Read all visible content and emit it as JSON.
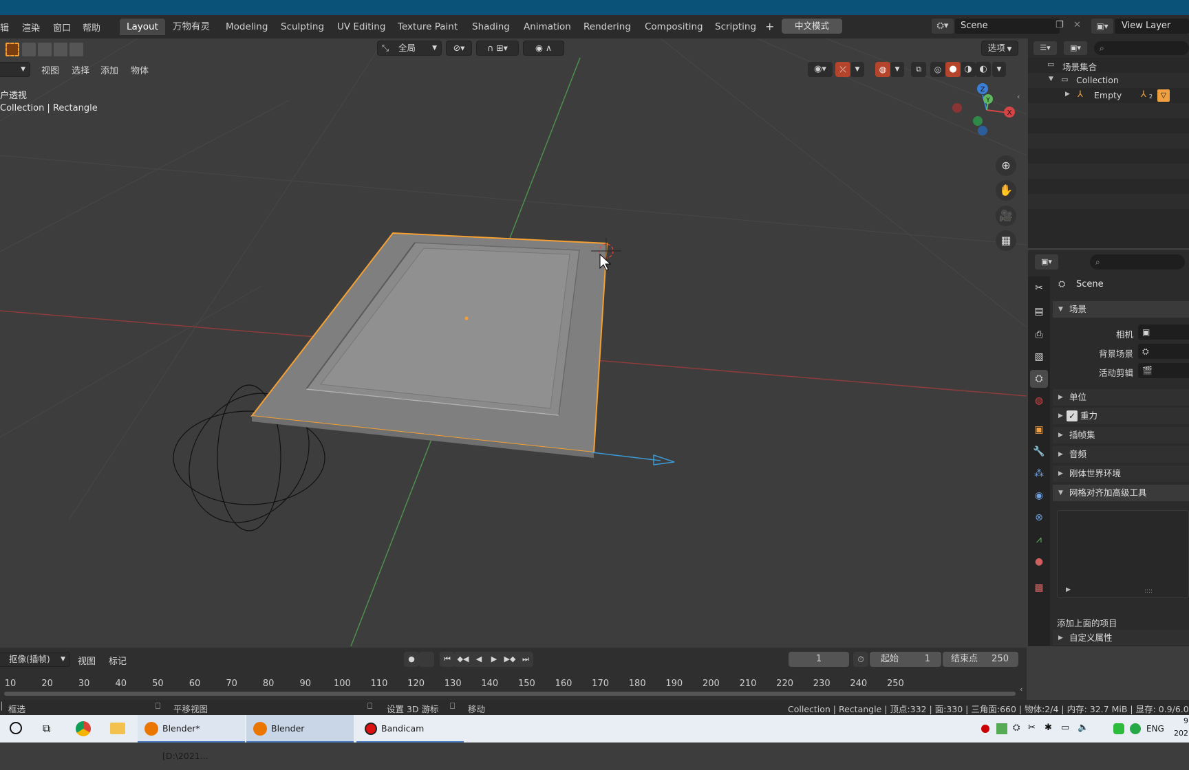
{
  "menubar": {
    "items": [
      "编辑",
      "渲染",
      "窗口",
      "帮助"
    ],
    "display_items": [
      "辑",
      "渲染",
      "窗口",
      "帮助"
    ]
  },
  "workspaces": [
    "Layout",
    "万物有灵",
    "Modeling",
    "Sculpting",
    "UV Editing",
    "Texture Paint",
    "Shading",
    "Animation",
    "Rendering",
    "Compositing",
    "Scripting"
  ],
  "active_workspace": "Layout",
  "add_workspace": "+",
  "chinese_mode": "中文模式",
  "scene_name": "Scene",
  "view_layer": "View Layer",
  "viewport": {
    "transform_orientation": "全局",
    "options_label": "选项",
    "menu": [
      "视图",
      "选择",
      "添加",
      "物体"
    ],
    "overlay_line1": "户透视",
    "overlay_line2": "Collection | Rectangle"
  },
  "outliner": {
    "scene_collection": "场景集合",
    "collection": "Collection",
    "empty": "Empty",
    "child_count": "2"
  },
  "properties": {
    "scene_label": "Scene",
    "panel_scene": "场景",
    "camera": "相机",
    "background_scene": "背景场景",
    "active_clip": "活动剪辑",
    "units": "单位",
    "gravity": "重力",
    "keying_sets": "插帧集",
    "audio": "音频",
    "rigid_body_world": "刚体世界环境",
    "mesh_align_tools": "网格对齐加高级工具",
    "add_item": "添加上面的项目",
    "custom_props": "自定义属性"
  },
  "timeline": {
    "mode": "抠像(插帧)",
    "view": "视图",
    "marker": "标记",
    "current_frame": "1",
    "start_label": "起始",
    "start_value": "1",
    "end_label": "结束点",
    "end_value": "250",
    "ticks": [
      "10",
      "20",
      "30",
      "40",
      "50",
      "60",
      "70",
      "80",
      "90",
      "100",
      "110",
      "120",
      "130",
      "140",
      "150",
      "160",
      "170",
      "180",
      "190",
      "200",
      "210",
      "220",
      "230",
      "240",
      "250"
    ]
  },
  "statusbar": {
    "box_select": "框选",
    "pan_view": "平移视图",
    "set_cursor": "设置 3D 游标",
    "move": "移动",
    "stats": "Collection | Rectangle | 顶点:332 | 面:330 | 三角面:660 | 物体:2/4 | 内存: 32.7 MiB | 显存: 0.9/6.0"
  },
  "taskbar": {
    "apps": [
      "Blender* [D:\\2021...",
      "Blender",
      "Bandicam"
    ],
    "lang": "ENG",
    "clock_partial_1": "9",
    "clock_partial_2": "202"
  },
  "colors": {
    "title": "#0a5278",
    "selection": "#f5a033",
    "x_axis": "#9b3b3b",
    "y_axis": "#4f9b4f",
    "z_gizmo": "#3b7fd6"
  }
}
